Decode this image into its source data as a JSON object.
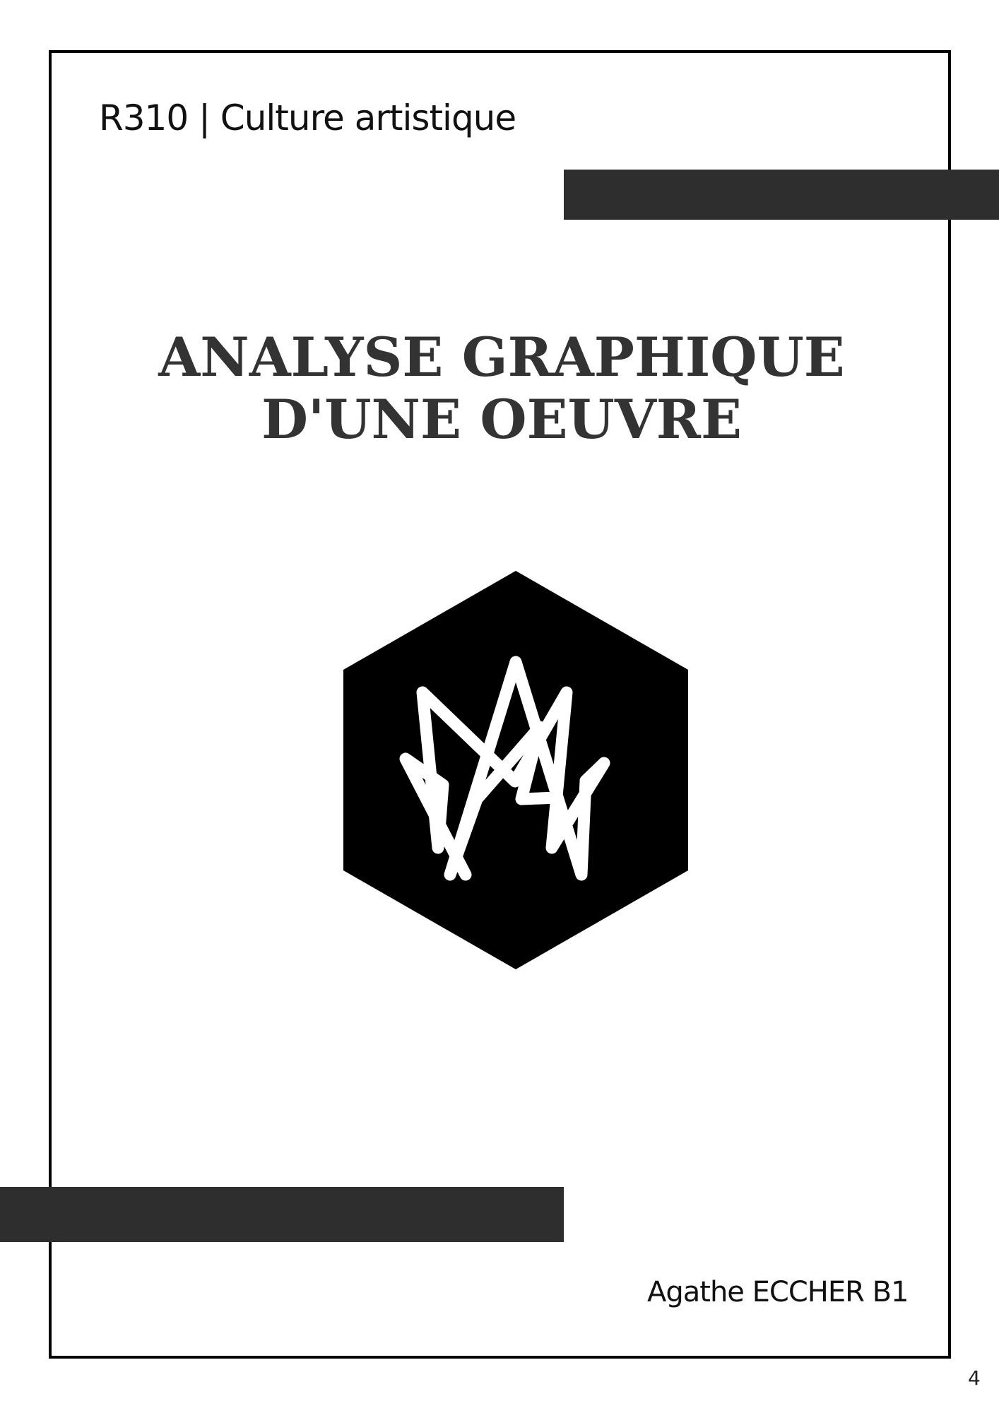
{
  "header": {
    "course": "R310 | Culture artistique"
  },
  "title": {
    "line1": "ANALYSE GRAPHIQUE",
    "line2": "D'UNE OEUVRE"
  },
  "logo": {
    "icon": "hexagon-crown-logo-icon",
    "fill": "#000000",
    "stroke": "#ffffff"
  },
  "footer": {
    "author": "Agathe ECCHER B1",
    "page_number": "4"
  },
  "colors": {
    "bar": "#2e2e2e",
    "frame": "#000000",
    "title": "#333333"
  }
}
